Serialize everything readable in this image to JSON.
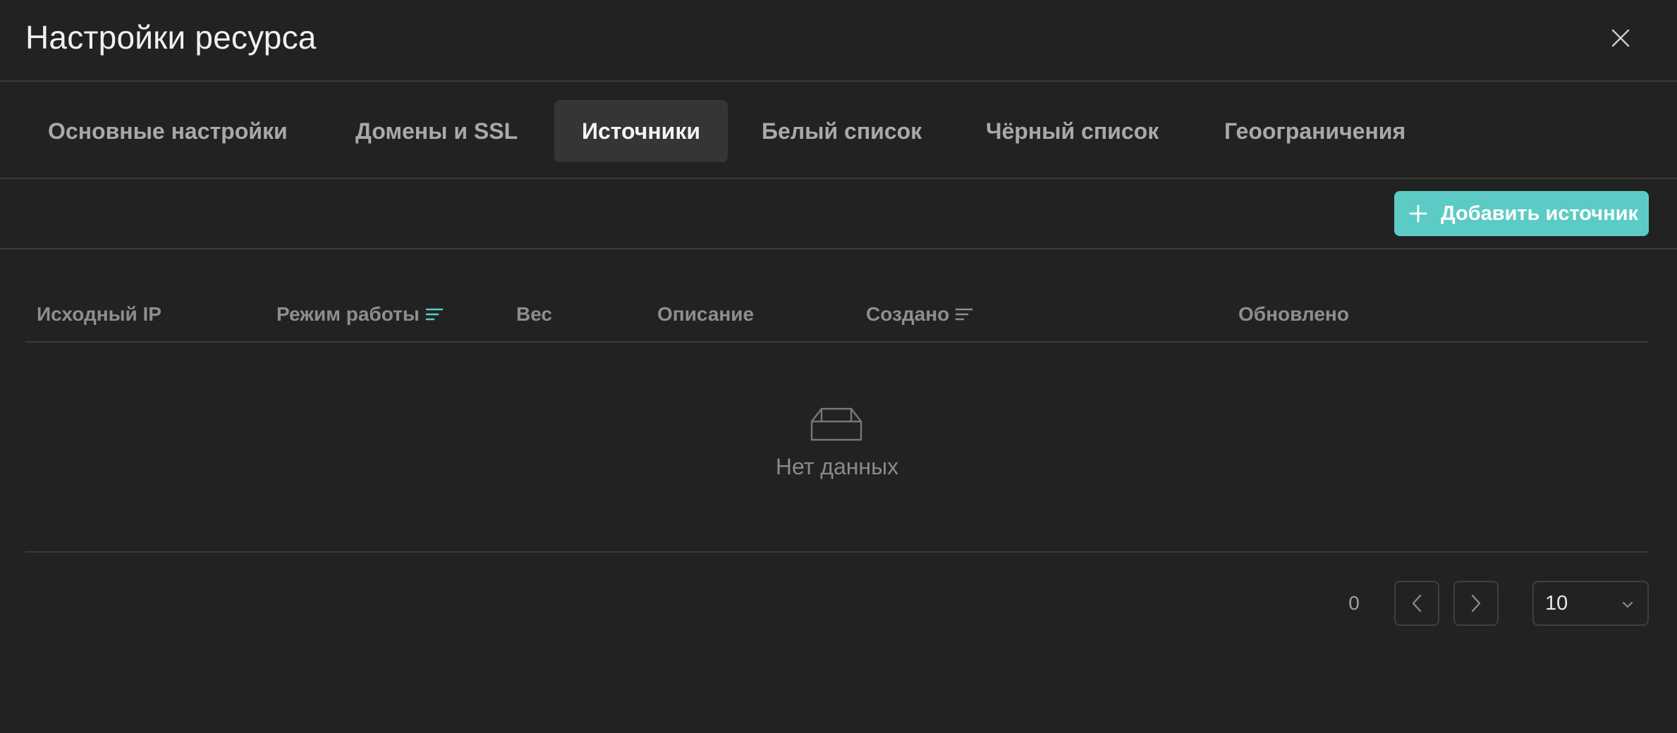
{
  "header": {
    "title": "Настройки ресурса",
    "close_icon": "close-icon"
  },
  "tabs": [
    {
      "label": "Основные настройки",
      "active": false
    },
    {
      "label": "Домены и SSL",
      "active": false
    },
    {
      "label": "Источники",
      "active": true
    },
    {
      "label": "Белый список",
      "active": false
    },
    {
      "label": "Чёрный список",
      "active": false
    },
    {
      "label": "Геоограничения",
      "active": false
    }
  ],
  "toolbar": {
    "add_label": "Добавить источник",
    "add_icon": "plus-icon"
  },
  "table": {
    "columns": [
      {
        "label": "Исходный IP",
        "sortable": false
      },
      {
        "label": "Режим работы",
        "sortable": true,
        "sort_active": true
      },
      {
        "label": "Вес",
        "sortable": false
      },
      {
        "label": "Описание",
        "sortable": false
      },
      {
        "label": "Создано",
        "sortable": true,
        "sort_active": false
      },
      {
        "label": "Обновлено",
        "sortable": false
      }
    ],
    "rows": [],
    "empty_text": "Нет данных",
    "empty_icon": "inbox-icon"
  },
  "pagination": {
    "total": "0",
    "page_size": "10",
    "prev_icon": "chevron-left-icon",
    "next_icon": "chevron-right-icon"
  },
  "colors": {
    "background": "#222222",
    "accent": "#5ccbc6",
    "active_tab_bg": "#353535",
    "divider": "#3a3a3a"
  }
}
